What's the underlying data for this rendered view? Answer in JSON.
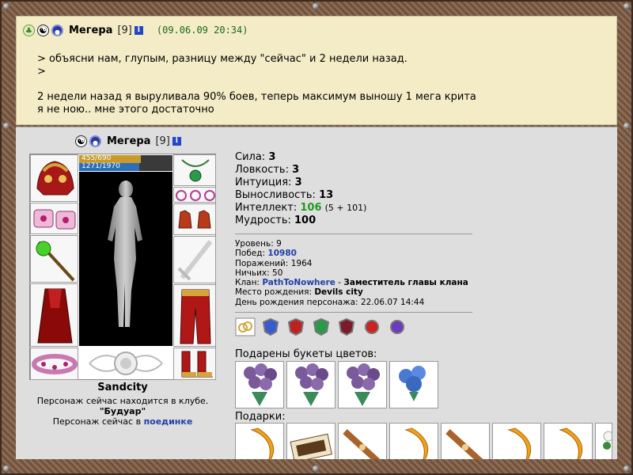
{
  "post": {
    "nick": "Мегера",
    "level": "[9]",
    "info": "i",
    "date": "(09.06.09 20:34)",
    "lines": [
      "> объясни нам, глупым, разницу между \"сейчас\" и 2 недели назад.",
      ">",
      "",
      "2 недели назад я выруливала 90% боев, теперь максимум выношу 1 мега крита",
      "я не ною.. мне этого достаточно"
    ]
  },
  "character": {
    "nick": "Мегера",
    "level": "[9]",
    "info": "i",
    "hp": {
      "text": "455/690",
      "current": 455,
      "max": 690,
      "color": "#c79a2a"
    },
    "mana": {
      "text": "1271/1970",
      "current": 1271,
      "max": 1970,
      "color": "#2a6fb8"
    },
    "city": "Sandcity",
    "club_text": "Персонаж сейчас находится в клубе.",
    "club_name": "\"Будуар\"",
    "duel_prefix": "Персонаж сейчас в",
    "duel_link": "поединке"
  },
  "stats": [
    {
      "label": "Сила:",
      "value": "3"
    },
    {
      "label": "Ловкость:",
      "value": "3"
    },
    {
      "label": "Интуиция:",
      "value": "3"
    },
    {
      "label": "Выносливость:",
      "value": "13"
    }
  ],
  "intellect": {
    "label": "Интеллект:",
    "value": "106",
    "extra": "(5 + 101)"
  },
  "wisdom": {
    "label": "Мудрость:",
    "value": "100"
  },
  "details": {
    "level_label": "Уровень:",
    "level_value": "9",
    "wins_label": "Побед:",
    "wins_value": "10980",
    "losses_label": "Поражений:",
    "losses_value": "1964",
    "draws_label": "Ничьих:",
    "draws_value": "50",
    "clan_label": "Клан:",
    "clan_name": "PathToNowhere",
    "clan_sep": " - ",
    "clan_role": "Заместитель главы клана",
    "birthplace_label": "Место рождения:",
    "birthplace_value": "Devils city",
    "birthday_label": "День рождения персонажа:",
    "birthday_value": "22.06.07 14:44"
  },
  "flowers_label": "Подарены букеты цветов:",
  "gifts_label": "Подарки:",
  "colors": {
    "post_bg": "#f4ecc6",
    "panel_bg": "#dedede",
    "link": "#1f3fa8",
    "date": "#1a6a1a",
    "intellect": "#1f9a1f"
  }
}
